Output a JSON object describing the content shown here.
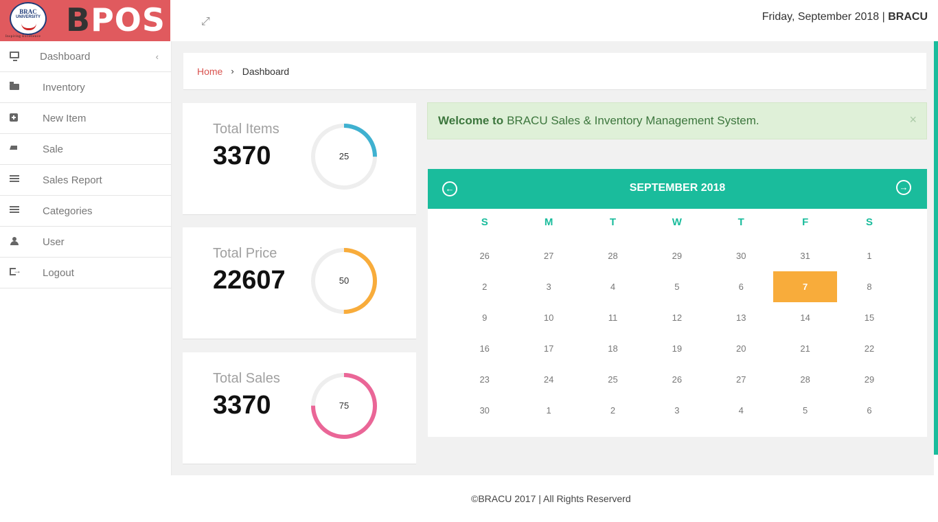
{
  "brand": {
    "seal_line1": "BRAC",
    "seal_line2": "UNIVERSITY",
    "tagline": "Inspiring Excellence",
    "name": "BPOS"
  },
  "sidebar": {
    "items": [
      {
        "label": "Dashboard",
        "icon": "monitor-icon"
      },
      {
        "label": "Inventory",
        "icon": "folder-icon"
      },
      {
        "label": "New Item",
        "icon": "plus-square-icon"
      },
      {
        "label": "Sale",
        "icon": "cart-icon"
      },
      {
        "label": "Sales Report",
        "icon": "list-icon"
      },
      {
        "label": "Categories",
        "icon": "bars-icon"
      },
      {
        "label": "User",
        "icon": "user-icon"
      },
      {
        "label": "Logout",
        "icon": "logout-icon"
      }
    ],
    "collapse_glyph": "‹"
  },
  "topbar": {
    "date_text": "Friday, September 2018",
    "separator": " | ",
    "org": "BRACU"
  },
  "breadcrumb": {
    "home": "Home",
    "separator": "›",
    "current": "Dashboard"
  },
  "stats": [
    {
      "title": "Total Items",
      "value": "3370",
      "ring_value": "25",
      "ring_percent": 25,
      "color": "#3fb1d0"
    },
    {
      "title": "Total Price",
      "value": "22607",
      "ring_value": "50",
      "ring_percent": 50,
      "color": "#f8ac3b"
    },
    {
      "title": "Total Sales",
      "value": "3370",
      "ring_value": "75",
      "ring_percent": 75,
      "color": "#ea6697"
    }
  ],
  "alert": {
    "strong": "Welcome to",
    "text": "BRACU Sales & Inventory Management System.",
    "close": "×"
  },
  "calendar": {
    "month_label": "SEPTEMBER 2018",
    "weekdays": [
      "S",
      "M",
      "T",
      "W",
      "T",
      "F",
      "S"
    ],
    "days": [
      "26",
      "27",
      "28",
      "29",
      "30",
      "31",
      "1",
      "2",
      "3",
      "4",
      "5",
      "6",
      "7",
      "8",
      "9",
      "10",
      "11",
      "12",
      "13",
      "14",
      "15",
      "16",
      "17",
      "18",
      "19",
      "20",
      "21",
      "22",
      "23",
      "24",
      "25",
      "26",
      "27",
      "28",
      "29",
      "30",
      "1",
      "2",
      "3",
      "4",
      "5",
      "6"
    ],
    "today": "7",
    "accent": "#1abc9c",
    "today_color": "#f8ac3b"
  },
  "footer": {
    "text": "©BRACU 2017 | All Rights Reserverd"
  }
}
